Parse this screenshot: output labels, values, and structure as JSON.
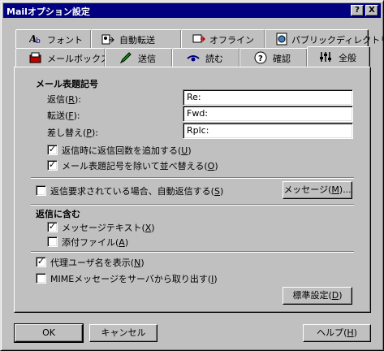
{
  "window": {
    "title": "Mailオプション設定",
    "help_button": "?",
    "close_button": "X"
  },
  "tabs_row1": [
    {
      "label": "フォント",
      "icon": "font-icon"
    },
    {
      "label": "自動転送",
      "icon": "auto-forward-icon"
    },
    {
      "label": "オフライン",
      "icon": "offline-icon"
    },
    {
      "label": "パブリックディレクトリ",
      "icon": "public-directory-icon"
    }
  ],
  "tabs_row2": [
    {
      "label": "メールボックス",
      "icon": "mailbox-icon"
    },
    {
      "label": "送信",
      "icon": "pencil-icon"
    },
    {
      "label": "読む",
      "icon": "read-icon"
    },
    {
      "label": "確認",
      "icon": "question-icon"
    },
    {
      "label": "全般",
      "icon": "general-icon",
      "selected": true
    }
  ],
  "subject_prefix": {
    "heading": "メール表題記号",
    "reply": {
      "label": "返信",
      "accel": "R",
      "value": "Re:"
    },
    "forward": {
      "label": "転送",
      "accel": "F",
      "value": "Fwd:"
    },
    "replace": {
      "label": "差し替え",
      "accel": "P",
      "value": "Rplc:"
    }
  },
  "checkbox_reply_count": {
    "label": "返信時に返信回数を追加する",
    "accel": "U",
    "checked": true
  },
  "checkbox_sort_without_prefix": {
    "label": "メール表題記号を除いて並べ替える",
    "accel": "O",
    "checked": true
  },
  "checkbox_auto_reply": {
    "label": "返信要求されている場合、自動返信する",
    "accel": "S",
    "checked": false
  },
  "message_button": {
    "label": "メッセージ",
    "accel": "M",
    "suffix": "..."
  },
  "include_in_reply": {
    "heading": "返信に含む",
    "message_text": {
      "label": "メッセージテキスト",
      "accel": "X",
      "checked": true
    },
    "attachment": {
      "label": "添付ファイル",
      "accel": "A",
      "checked": false
    }
  },
  "checkbox_show_delegate": {
    "label": "代理ユーザ名を表示",
    "accel": "N",
    "checked": true
  },
  "checkbox_mime_from_server": {
    "label": "MIMEメッセージをサーバから取り出す",
    "accel": "I",
    "checked": false
  },
  "default_button": {
    "label": "標準設定",
    "accel": "D"
  },
  "ok_button": {
    "label": "OK"
  },
  "cancel_button": {
    "label": "キャンセル"
  },
  "help_button": {
    "label": "ヘルプ",
    "accel": "H"
  },
  "colors": {
    "titlebar": "#000080",
    "face": "#c0c0c0"
  }
}
